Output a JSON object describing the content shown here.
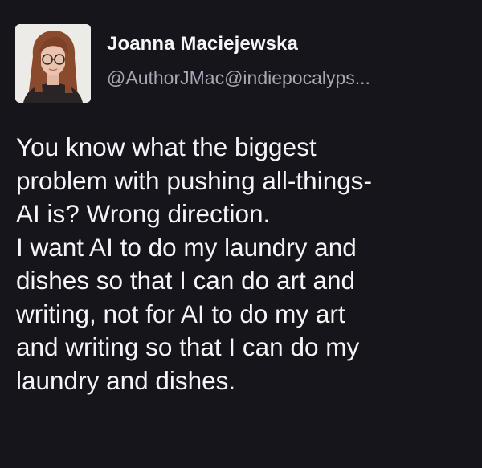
{
  "post": {
    "author": {
      "display_name": "Joanna Maciejewska",
      "handle": "@AuthorJMac@indiepocalyps..."
    },
    "lines": [
      "You know what the biggest",
      "problem with pushing all-things-",
      "AI is? Wrong direction.",
      "I want AI to do my laundry and",
      "dishes so that I can do art and",
      "writing, not for AI to do my art",
      "and writing so that I can do my",
      "laundry and dishes."
    ]
  },
  "colors": {
    "background": "#15151b",
    "text": "#f5f5f7",
    "handle": "#a7a8b4"
  }
}
